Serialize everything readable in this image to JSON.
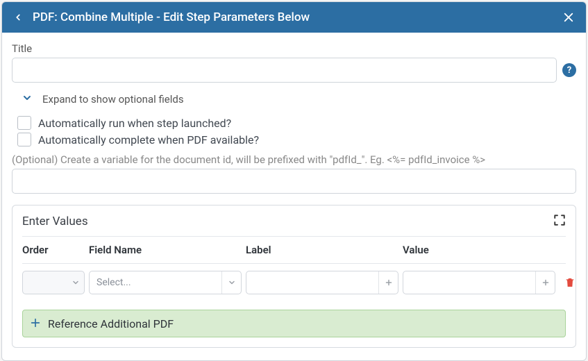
{
  "header": {
    "title": "PDF: Combine Multiple - Edit Step Parameters Below"
  },
  "form": {
    "title_label": "Title",
    "title_value": "",
    "expand_label": "Expand to show optional fields",
    "auto_run_label": "Automatically run when step launched?",
    "auto_complete_label": "Automatically complete when PDF available?",
    "var_hint": "(Optional) Create a variable for the document id, will be prefixed with \"pdfId_\". Eg. <%= pdfId_invoice %>",
    "var_value": ""
  },
  "values_panel": {
    "title": "Enter Values",
    "columns": {
      "order": "Order",
      "field_name": "Field Name",
      "label": "Label",
      "value": "Value"
    },
    "row": {
      "field_name_placeholder": "Select..."
    },
    "reference_label": "Reference Additional PDF"
  }
}
